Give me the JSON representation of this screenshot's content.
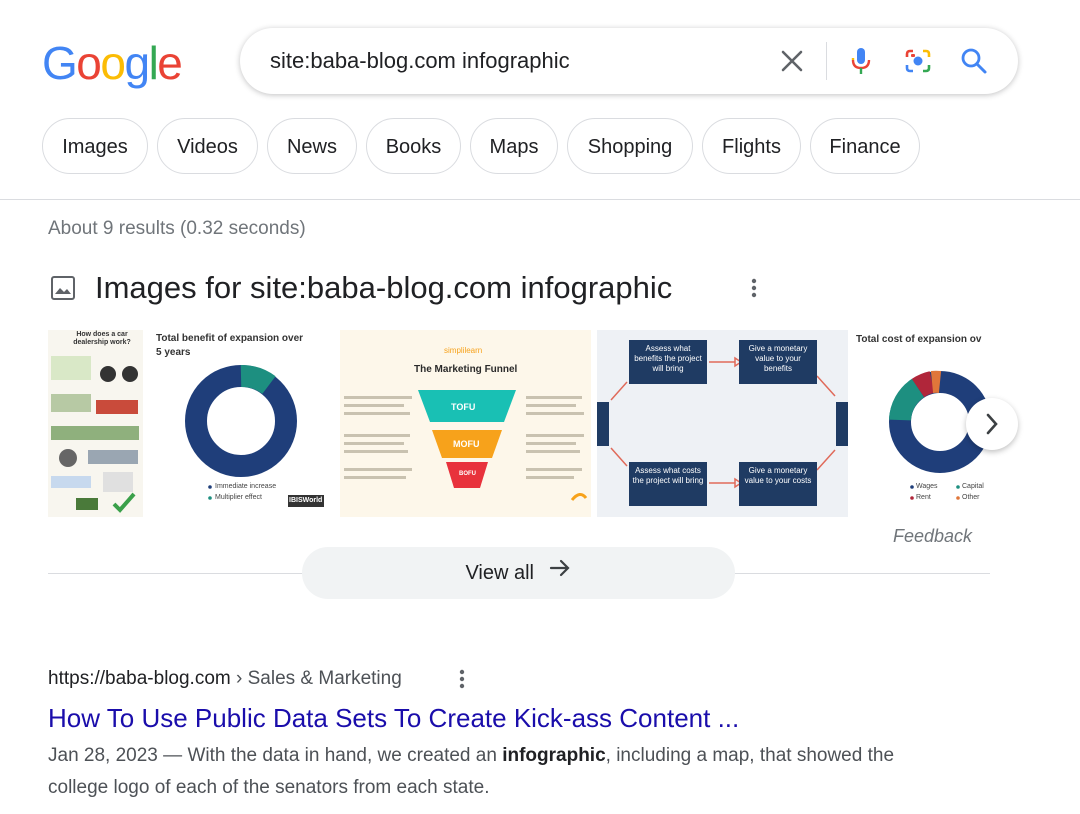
{
  "logo": {
    "text": "Google",
    "letters": [
      "G",
      "o",
      "o",
      "g",
      "l",
      "e"
    ],
    "colors": [
      "#4285F4",
      "#EA4335",
      "#FBBC05",
      "#4285F4",
      "#34A853",
      "#EA4335"
    ]
  },
  "search": {
    "query": "site:baba-blog.com infographic"
  },
  "icons": {
    "clear": "close-icon",
    "voice": "microphone-icon",
    "lens": "camera-lens-icon",
    "search": "search-icon"
  },
  "chips": [
    "Images",
    "Videos",
    "News",
    "Books",
    "Maps",
    "Shopping",
    "Flights",
    "Finance"
  ],
  "stats": "About 9 results (0.32 seconds)",
  "images_section": {
    "title": "Images for site:baba-blog.com infographic",
    "thumbs": {
      "t1": {
        "title": "How does a car dealership work?"
      },
      "t2": {
        "title": "Total benefit of expansion over",
        "title2": "5 years",
        "legend": [
          "Immediate increase",
          "Multiplier effect"
        ],
        "brand": "IBISWorld"
      },
      "t3": {
        "brand": "simplilearn",
        "title": "The Marketing Funnel",
        "stages": [
          "TOFU",
          "MOFU",
          "BOFU"
        ]
      },
      "t4": {
        "boxes": [
          "Assess what benefits the project will bring",
          "Give a monetary value to your benefits",
          "Assess what costs the project will bring",
          "Give a monetary value to your costs"
        ]
      },
      "t5": {
        "title": "Total cost of expansion ov",
        "legend": [
          "Wages",
          "Capital",
          "Rent",
          "Other"
        ]
      }
    },
    "feedback": "Feedback",
    "view_all": "View all"
  },
  "accent_colors": {
    "link": "#1a0dab",
    "navy": "#1f3e7a",
    "teal": "#1d8f80",
    "tofu": "#19c0b4",
    "mofu": "#f7a21b",
    "bofu": "#e8323c"
  },
  "result": {
    "url": "https://baba-blog.com",
    "crumb": " › Sales & Marketing",
    "title": "How To Use Public Data Sets To Create Kick-ass Content ...",
    "date": "Jan 28, 2023",
    "dash": " — ",
    "snippet_before": "With the data in hand, we created an ",
    "snippet_bold": "infographic",
    "snippet_after": ", including a map, that showed the college logo of each of the senators from each state."
  }
}
